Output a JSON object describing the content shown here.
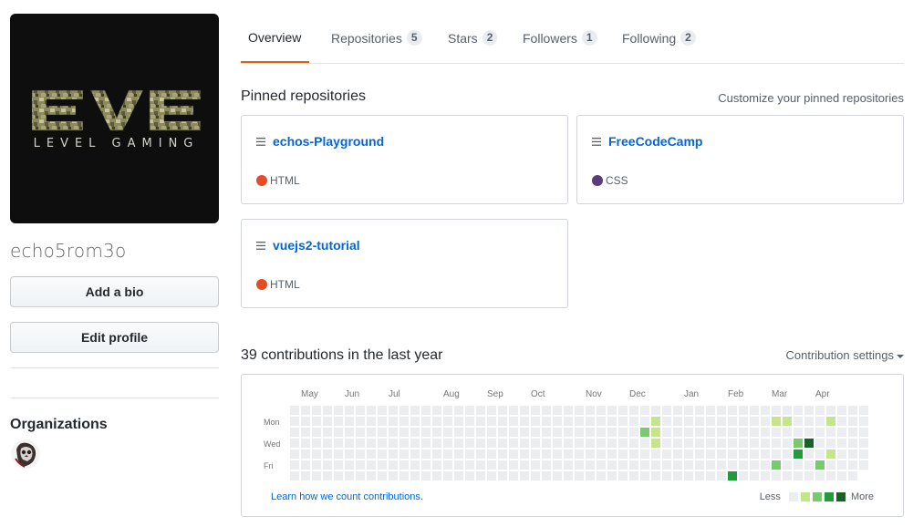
{
  "profile": {
    "logo_text": "LEVEL GAMING",
    "username": "echo5rom3o",
    "add_bio_label": "Add a bio",
    "edit_profile_label": "Edit profile",
    "organizations_title": "Organizations"
  },
  "tabs": [
    {
      "label": "Overview",
      "count": null,
      "selected": true
    },
    {
      "label": "Repositories",
      "count": "5",
      "selected": false
    },
    {
      "label": "Stars",
      "count": "2",
      "selected": false
    },
    {
      "label": "Followers",
      "count": "1",
      "selected": false
    },
    {
      "label": "Following",
      "count": "2",
      "selected": false
    }
  ],
  "pinned": {
    "title": "Pinned repositories",
    "customize_label": "Customize your pinned repositories",
    "repos": [
      {
        "name": "echos-Playground",
        "language": "HTML",
        "lang_color": "#e34c26"
      },
      {
        "name": "FreeCodeCamp",
        "language": "CSS",
        "lang_color": "#563d7c"
      },
      {
        "name": "vuejs2-tutorial",
        "language": "HTML",
        "lang_color": "#e34c26"
      }
    ]
  },
  "contributions": {
    "title": "39 contributions in the last year",
    "settings_label": "Contribution settings",
    "months": [
      "May",
      "Jun",
      "Jul",
      "Aug",
      "Sep",
      "Oct",
      "Nov",
      "Dec",
      "Jan",
      "Feb",
      "Mar",
      "Apr"
    ],
    "days": [
      "Mon",
      "Wed",
      "Fri"
    ],
    "learn_label": "Learn how we count contributions.",
    "less_label": "Less",
    "more_label": "More",
    "colors": [
      "#ebedf0",
      "#c6e48b",
      "#7bc96f",
      "#239a3b",
      "#196127"
    ],
    "weeks": 53,
    "active_cells": [
      {
        "week": 32,
        "day": 2,
        "level": 2
      },
      {
        "week": 33,
        "day": 1,
        "level": 1
      },
      {
        "week": 33,
        "day": 2,
        "level": 1
      },
      {
        "week": 33,
        "day": 3,
        "level": 1
      },
      {
        "week": 40,
        "day": 6,
        "level": 3
      },
      {
        "week": 44,
        "day": 1,
        "level": 1
      },
      {
        "week": 44,
        "day": 5,
        "level": 2
      },
      {
        "week": 44,
        "day": 7,
        "level": 1
      },
      {
        "week": 45,
        "day": 1,
        "level": 1
      },
      {
        "week": 45,
        "day": 7,
        "level": 2
      },
      {
        "week": 46,
        "day": 3,
        "level": 2
      },
      {
        "week": 46,
        "day": 4,
        "level": 3
      },
      {
        "week": 47,
        "day": 3,
        "level": 4
      },
      {
        "week": 48,
        "day": 5,
        "level": 2
      },
      {
        "week": 49,
        "day": 1,
        "level": 1
      },
      {
        "week": 49,
        "day": 4,
        "level": 1
      }
    ]
  }
}
